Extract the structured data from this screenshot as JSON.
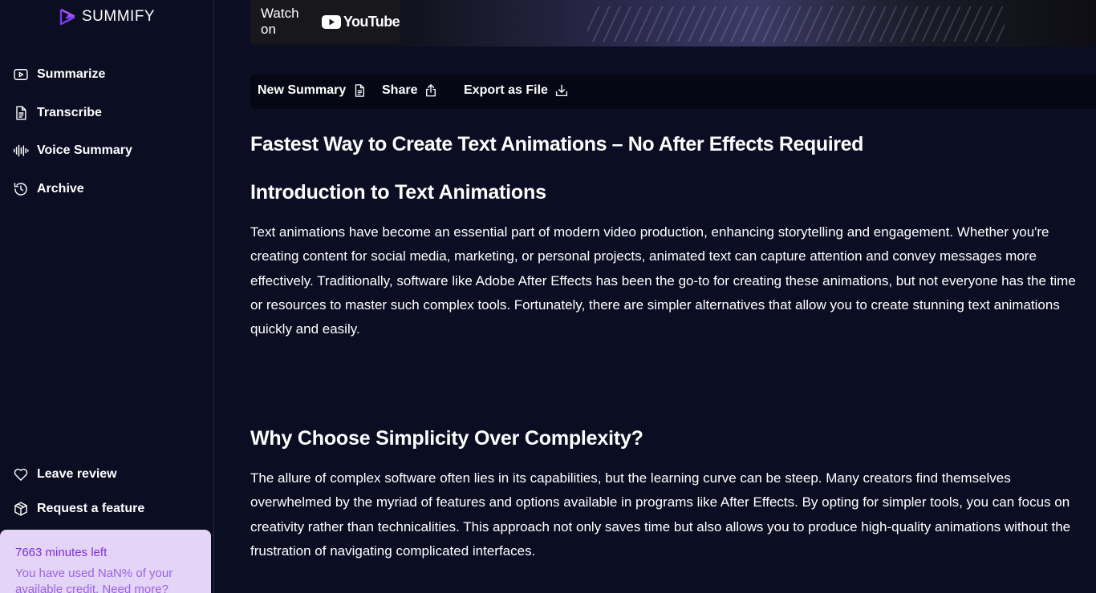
{
  "sidebar": {
    "logo_text": "SUMMIFY",
    "nav": [
      {
        "label": "Summarize",
        "icon": "video-play-icon"
      },
      {
        "label": "Transcribe",
        "icon": "document-icon"
      },
      {
        "label": "Voice Summary",
        "icon": "waveform-icon"
      },
      {
        "label": "Archive",
        "icon": "history-icon"
      }
    ],
    "bottom": [
      {
        "label": "Leave review",
        "icon": "heart-icon"
      },
      {
        "label": "Request a feature",
        "icon": "package-icon"
      }
    ],
    "credit": {
      "minutes_left": "7663 minutes left",
      "usage_text": "You have used NaN% of your available credit. Need more?"
    }
  },
  "video": {
    "watch_on": "Watch on",
    "brand": "YouTube"
  },
  "toolbar": {
    "new_summary": "New Summary",
    "share": "Share",
    "export": "Export as File"
  },
  "article": {
    "title": "Fastest Way to Create Text Animations – No After Effects Required",
    "sections": [
      {
        "heading": "Introduction to Text Animations",
        "body": "Text animations have become an essential part of modern video production, enhancing storytelling and engagement. Whether you're creating content for social media, marketing, or personal projects, animated text can capture attention and convey messages more effectively. Traditionally, software like Adobe After Effects has been the go-to for creating these animations, but not everyone has the time or resources to master such complex tools. Fortunately, there are simpler alternatives that allow you to create stunning text animations quickly and easily."
      },
      {
        "heading": "Why Choose Simplicity Over Complexity?",
        "body": "The allure of complex software often lies in its capabilities, but the learning curve can be steep. Many creators find themselves overwhelmed by the myriad of features and options available in programs like After Effects. By opting for simpler tools, you can focus on creativity rather than technicalities. This approach not only saves time but also allows you to produce high-quality animations without the frustration of navigating complicated interfaces."
      }
    ]
  },
  "colors": {
    "background": "#0b0e23",
    "accent": "#a855f7",
    "credit_bg": "#e4d4f6",
    "credit_text": "#7b2fe0"
  }
}
